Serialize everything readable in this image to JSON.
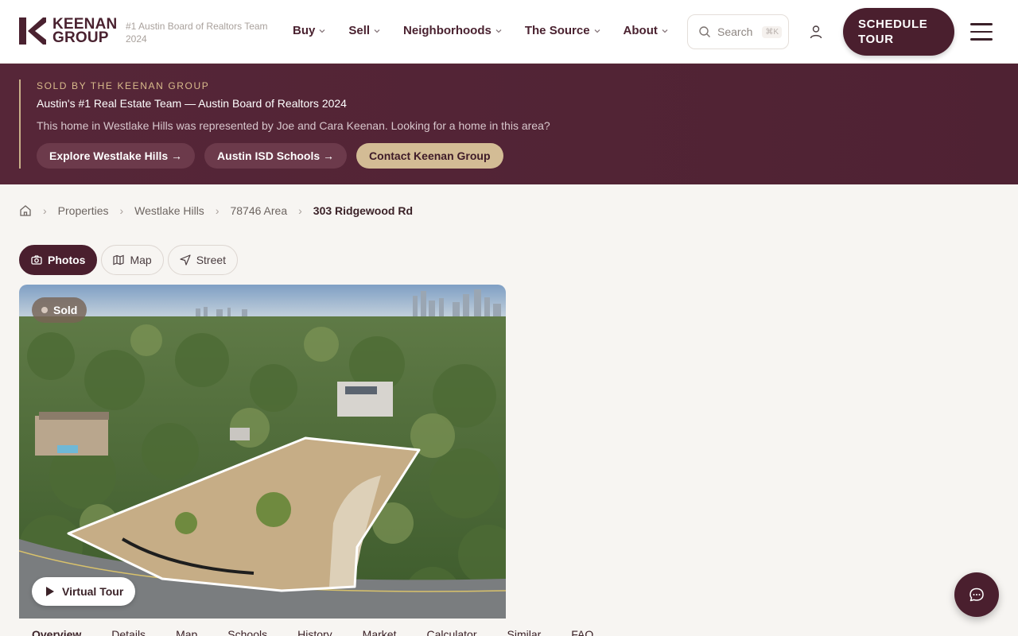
{
  "header": {
    "logo_line1": "KEENAN",
    "logo_line2": "GROUP",
    "tagline": "#1 Austin Board of Realtors Team 2024",
    "nav": [
      {
        "label": "Buy"
      },
      {
        "label": "Sell"
      },
      {
        "label": "Neighborhoods"
      },
      {
        "label": "The Source"
      },
      {
        "label": "About"
      }
    ],
    "search_placeholder": "Search",
    "search_shortcut": "⌘K",
    "cta_label": "SCHEDULE TOUR"
  },
  "banner": {
    "kicker": "SOLD BY THE KEENAN GROUP",
    "title": "Austin's #1 Real Estate Team — Austin Board of Realtors 2024",
    "description": "This home in Westlake Hills was represented by Joe and Cara Keenan. Looking for a home in this area?",
    "buttons": [
      {
        "label": "Explore Westlake Hills →"
      },
      {
        "label": "Austin ISD Schools →"
      },
      {
        "label": "Contact Keenan Group"
      }
    ]
  },
  "breadcrumb": {
    "items": [
      "Properties",
      "Westlake Hills",
      "78746 Area",
      "303 Ridgewood Rd"
    ]
  },
  "view_tabs": [
    {
      "label": "Photos",
      "icon": "camera-icon",
      "active": true
    },
    {
      "label": "Map",
      "icon": "map-icon",
      "active": false
    },
    {
      "label": "Street",
      "icon": "navigation-arrow-icon",
      "active": false
    }
  ],
  "photo": {
    "status_badge": "Sold",
    "virtual_tour_label": "Virtual Tour"
  },
  "section_tabs": [
    "Overview",
    "Details",
    "Map",
    "Schools",
    "History",
    "Market",
    "Calculator",
    "Similar",
    "FAQ"
  ],
  "colors": {
    "brand": "#4a1f2e",
    "banner": "#562638",
    "accent_gold": "#d3bc95"
  }
}
